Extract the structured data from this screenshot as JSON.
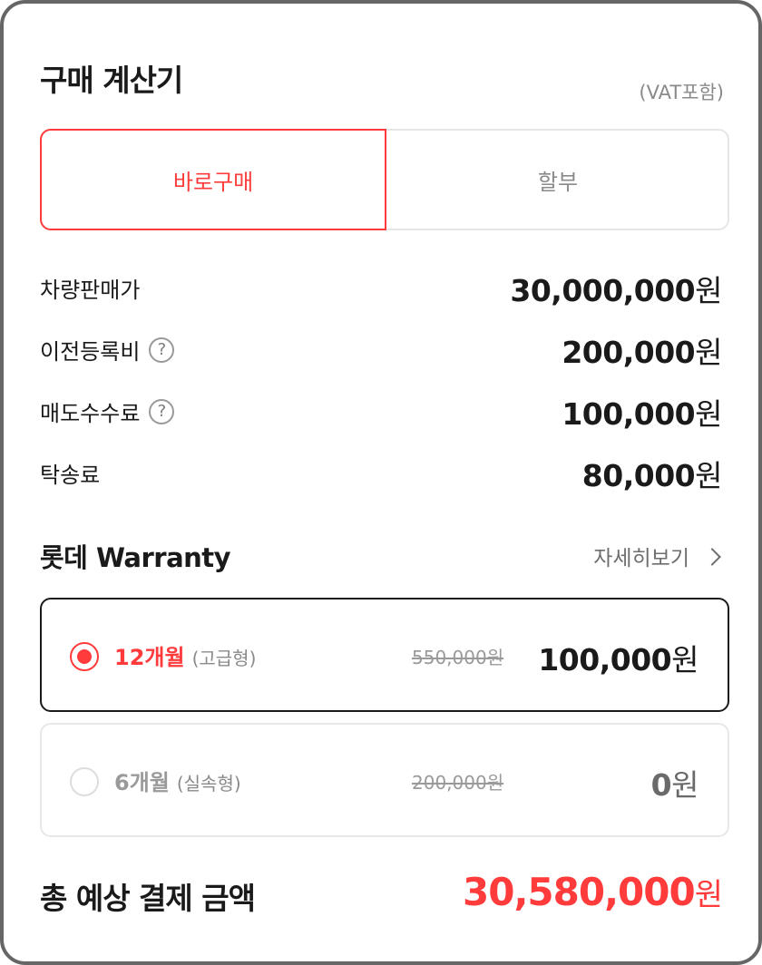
{
  "header": {
    "title": "구매 계산기",
    "vat_note": "(VAT포함)"
  },
  "tabs": [
    {
      "label": "바로구매",
      "active": true
    },
    {
      "label": "할부",
      "active": false
    }
  ],
  "fees": [
    {
      "label": "차량판매가",
      "amount": "30,000,000",
      "unit": "원",
      "help": false
    },
    {
      "label": "이전등록비",
      "amount": "200,000",
      "unit": "원",
      "help": true
    },
    {
      "label": "매도수수료",
      "amount": "100,000",
      "unit": "원",
      "help": true
    },
    {
      "label": "탁송료",
      "amount": "80,000",
      "unit": "원",
      "help": false
    }
  ],
  "help_icon": {
    "glyph": "?",
    "icon": "question-circle-icon"
  },
  "warranty": {
    "title": "롯데 Warranty",
    "details_label": "자세히보기",
    "options": [
      {
        "period": "12개월",
        "type": "(고급형)",
        "original_price": "550,000원",
        "price": "100,000",
        "unit": "원",
        "selected": true
      },
      {
        "period": "6개월",
        "type": "(실속형)",
        "original_price": "200,000원",
        "price": "0",
        "unit": "원",
        "selected": false
      }
    ]
  },
  "total": {
    "label": "총 예상 결제 금액",
    "amount": "30,580,000",
    "unit": "원"
  },
  "colors": {
    "accent": "#ff3b3b",
    "text": "#1a1a1a",
    "muted": "#8a8a8a",
    "border": "#e6e6e6"
  }
}
